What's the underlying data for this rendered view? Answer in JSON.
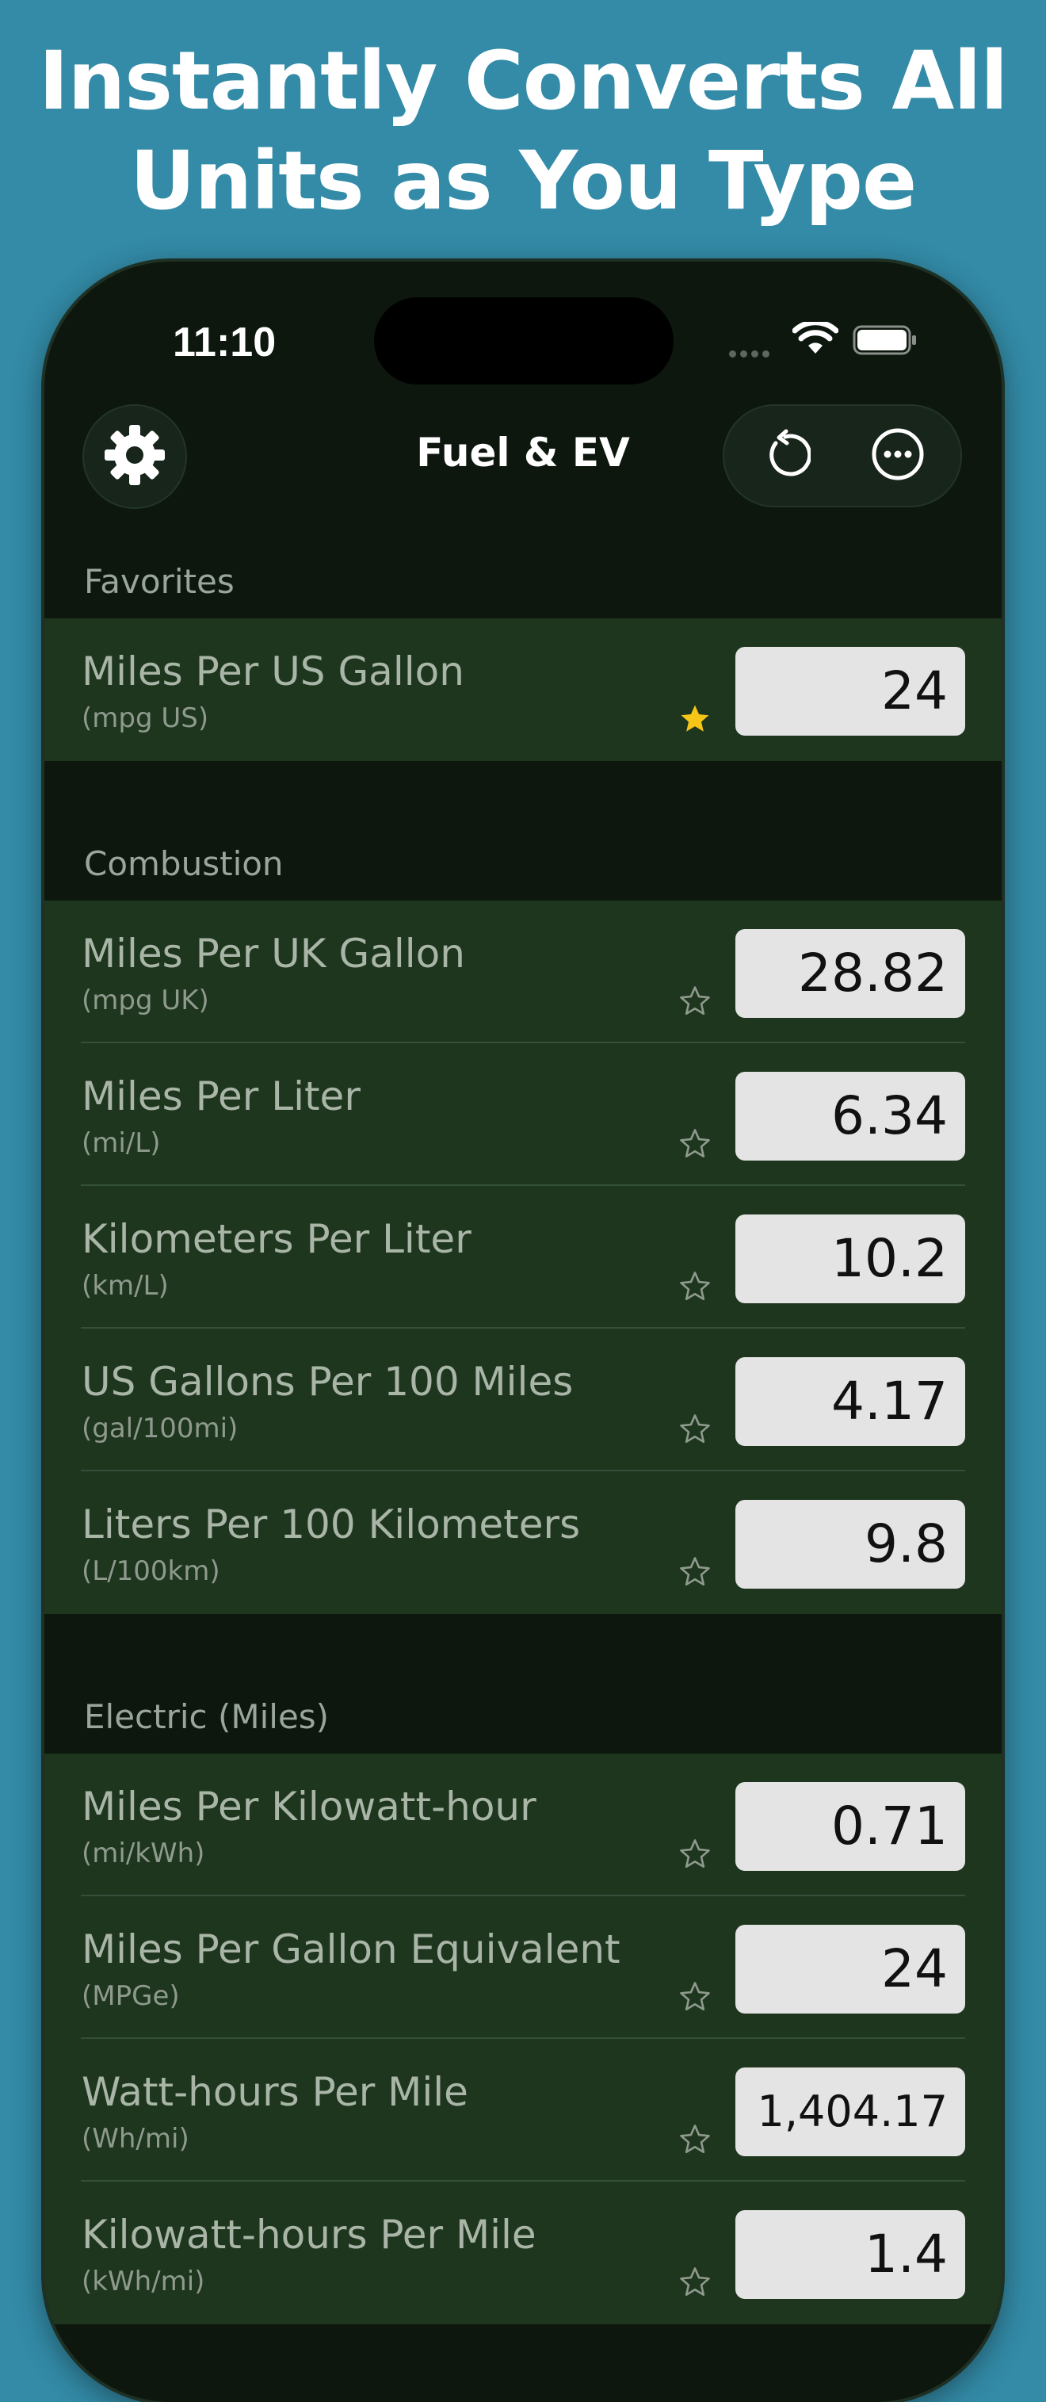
{
  "headline": {
    "line1": "Instantly Converts All",
    "line2": "Units as You Type"
  },
  "status_bar": {
    "time": "11:10"
  },
  "nav": {
    "title": "Fuel & EV"
  },
  "sections": [
    {
      "label": "Favorites",
      "rows": [
        {
          "name": "Miles Per US Gallon",
          "abbr": "(mpg US)",
          "value": "24",
          "favorite": true
        }
      ]
    },
    {
      "label": "Combustion",
      "rows": [
        {
          "name": "Miles Per UK Gallon",
          "abbr": "(mpg UK)",
          "value": "28.82",
          "favorite": false
        },
        {
          "name": "Miles Per Liter",
          "abbr": "(mi/L)",
          "value": "6.34",
          "favorite": false
        },
        {
          "name": "Kilometers Per Liter",
          "abbr": "(km/L)",
          "value": "10.2",
          "favorite": false
        },
        {
          "name": "US Gallons Per 100 Miles",
          "abbr": "(gal/100mi)",
          "value": "4.17",
          "favorite": false
        },
        {
          "name": "Liters Per 100 Kilometers",
          "abbr": "(L/100km)",
          "value": "9.8",
          "favorite": false
        }
      ]
    },
    {
      "label": "Electric (Miles)",
      "rows": [
        {
          "name": "Miles Per Kilowatt-hour",
          "abbr": "(mi/kWh)",
          "value": "0.71",
          "favorite": false
        },
        {
          "name": "Miles Per Gallon Equivalent",
          "abbr": "(MPGe)",
          "value": "24",
          "favorite": false
        },
        {
          "name": "Watt-hours Per Mile",
          "abbr": "(Wh/mi)",
          "value": "1,404.17",
          "favorite": false
        },
        {
          "name": "Kilowatt-hours Per Mile",
          "abbr": "(kWh/mi)",
          "value": "1.4",
          "favorite": false
        }
      ]
    }
  ],
  "colors": {
    "background": "#338ba7",
    "phone": "#0d170e",
    "row_background": "#1e351e",
    "favorite_star": "#f5c518",
    "empty_star": "#8e9a8d"
  },
  "icons": {
    "settings": "gear-icon",
    "reset": "rotate-ccw-icon",
    "more": "ellipsis-circle-icon",
    "favorite": "star-filled-icon",
    "not_favorite": "star-outline-icon"
  }
}
